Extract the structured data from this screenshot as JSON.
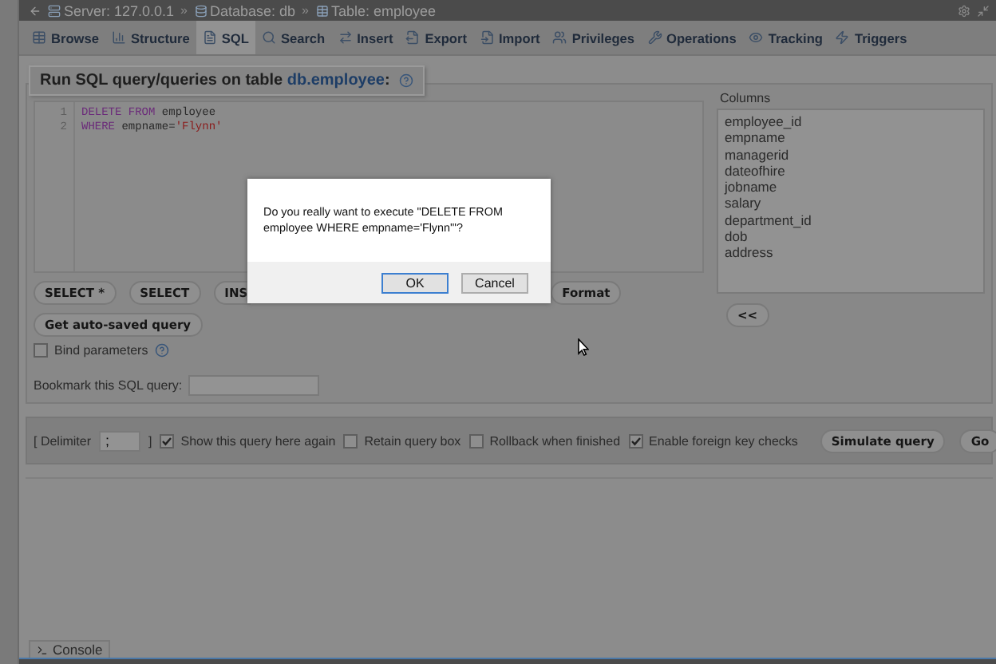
{
  "breadcrumb": [
    {
      "label": "Server: 127.0.0.1"
    },
    {
      "label": "Database: db"
    },
    {
      "label": "Table: employee"
    }
  ],
  "tabs": [
    {
      "label": "Browse",
      "selected": false
    },
    {
      "label": "Structure",
      "selected": false
    },
    {
      "label": "SQL",
      "selected": true
    },
    {
      "label": "Search",
      "selected": false
    },
    {
      "label": "Insert",
      "selected": false
    },
    {
      "label": "Export",
      "selected": false
    },
    {
      "label": "Import",
      "selected": false
    },
    {
      "label": "Privileges",
      "selected": false
    },
    {
      "label": "Operations",
      "selected": false
    },
    {
      "label": "Tracking",
      "selected": false
    },
    {
      "label": "Triggers",
      "selected": false
    }
  ],
  "query_panel": {
    "title": "Run SQL query/queries on table",
    "table_link": "db.employee",
    "title_end": ":",
    "editor_lines": [
      {
        "number": "1",
        "tokens": [
          {
            "text": "DELETE FROM",
            "kind": "keyword"
          },
          {
            "text": " employee",
            "kind": "plain"
          }
        ]
      },
      {
        "number": "2",
        "tokens": [
          {
            "text": "WHERE",
            "kind": "keyword"
          },
          {
            "text": " empname=",
            "kind": "plain"
          },
          {
            "text": "'Flynn'",
            "kind": "string"
          }
        ]
      }
    ],
    "columns_label": "Columns",
    "columns": [
      "employee_id",
      "empname",
      "managerid",
      "dateofhire",
      "jobname",
      "salary",
      "department_id",
      "dob",
      "address"
    ],
    "insert_button": "<<",
    "query_buttons": [
      {
        "label": "SELECT *",
        "cut": false
      },
      {
        "label": "SELECT",
        "cut": false
      },
      {
        "label": "INS",
        "cut": true
      },
      {
        "label": "Format",
        "cut": false
      }
    ],
    "autosave_button": "Get auto-saved query",
    "bind_parameters": {
      "label": "Bind parameters",
      "checked": false
    },
    "bookmark_label": "Bookmark this SQL query:"
  },
  "options_bar": {
    "delimiter_open": "[ Delimiter",
    "delimiter_value": ";",
    "delimiter_close": "]",
    "options": [
      {
        "label": "Show this query here again",
        "checked": true
      },
      {
        "label": "Retain query box",
        "checked": false
      },
      {
        "label": "Rollback when finished",
        "checked": false
      },
      {
        "label": "Enable foreign key checks",
        "checked": true
      }
    ],
    "buttons": [
      "Simulate query",
      "Go"
    ]
  },
  "console_tab": "Console",
  "breadcrumb_separator": "»",
  "dialog": {
    "message": "Do you really want to execute \"DELETE FROM employee WHERE empname='Flynn'\"?",
    "buttons": [
      {
        "label": "OK",
        "focused": true
      },
      {
        "label": "Cancel",
        "focused": false
      }
    ]
  }
}
